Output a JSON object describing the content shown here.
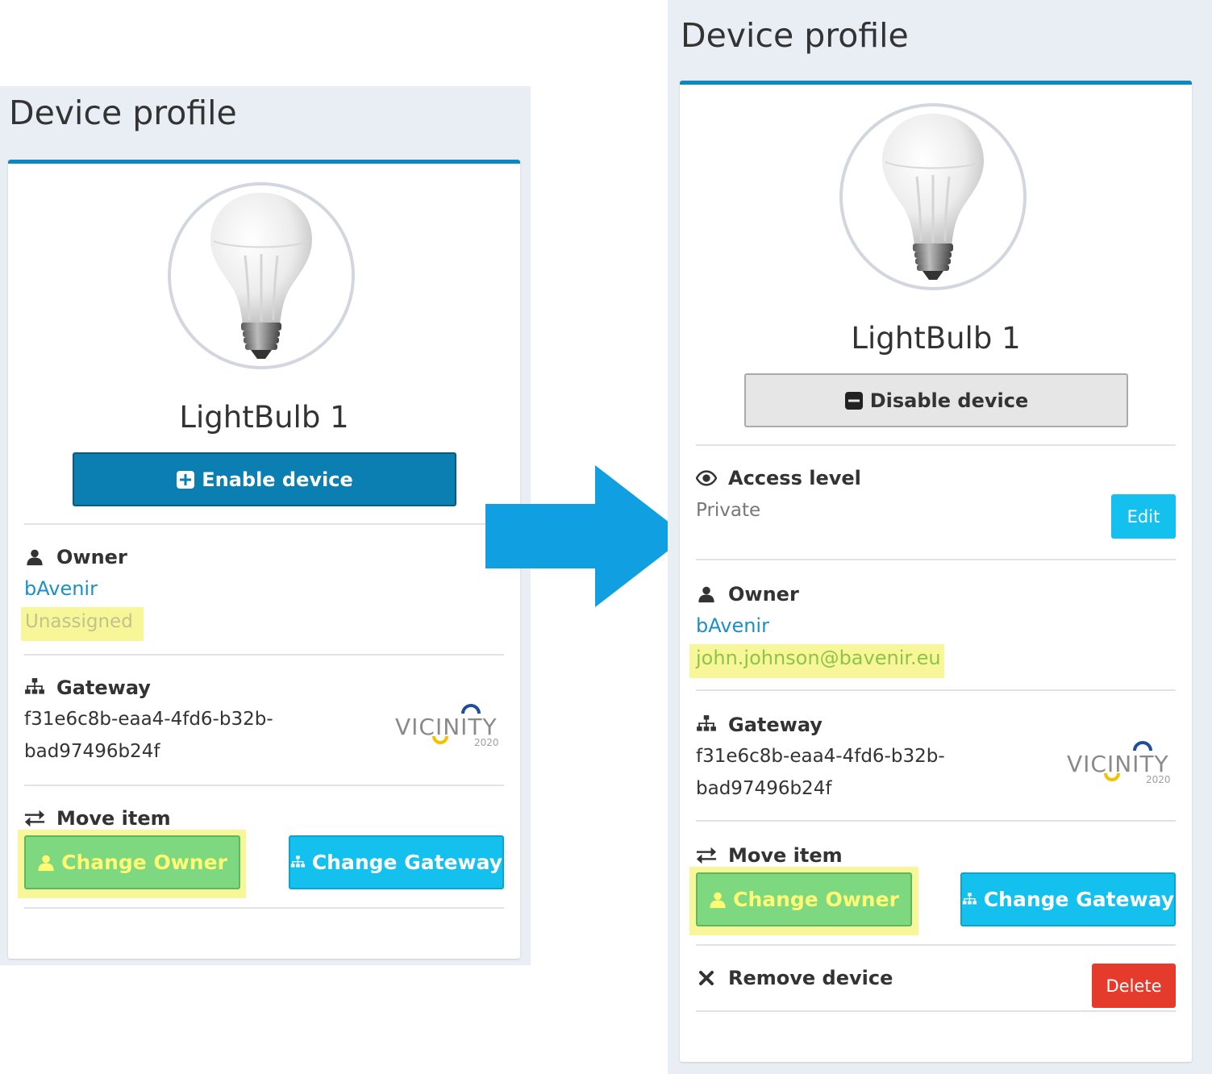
{
  "left": {
    "title": "Device profile",
    "device_name": "LightBulb 1",
    "enable_button": "Enable device",
    "owner": {
      "label": "Owner",
      "org": "bAvenir",
      "user": "Unassigned"
    },
    "gateway": {
      "label": "Gateway",
      "id_line1": "f31e6c8b-eaa4-4fd6-b32b-",
      "id_line2": "bad97496b24f"
    },
    "move": {
      "label": "Move item",
      "change_owner": "Change Owner",
      "change_gateway": "Change Gateway"
    }
  },
  "right": {
    "title": "Device profile",
    "device_name": "LightBulb 1",
    "disable_button": "Disable device",
    "access": {
      "label": "Access level",
      "value": "Private",
      "edit": "Edit"
    },
    "owner": {
      "label": "Owner",
      "org": "bAvenir",
      "user": "john.johnson@bavenir.eu"
    },
    "gateway": {
      "label": "Gateway",
      "id_line1": "f31e6c8b-eaa4-4fd6-b32b-",
      "id_line2": "bad97496b24f"
    },
    "move": {
      "label": "Move item",
      "change_owner": "Change Owner",
      "change_gateway": "Change Gateway"
    },
    "remove": {
      "label": "Remove device",
      "delete": "Delete"
    }
  },
  "logo": {
    "text": "VICINITY",
    "year": "2020"
  },
  "icons": {
    "enable": "plus-square-icon",
    "disable": "minus-square-icon",
    "access": "eye-icon",
    "owner": "user-icon",
    "gateway": "sitemap-icon",
    "move": "exchange-icon",
    "remove": "close-icon",
    "transition": "right-arrow-icon"
  },
  "colors": {
    "accent": "#0a88c4",
    "success": "#7dd87f",
    "info": "#14c0ee",
    "danger": "#e53b2c",
    "highlight": "#f7f79a",
    "link": "#1c8fc9"
  }
}
